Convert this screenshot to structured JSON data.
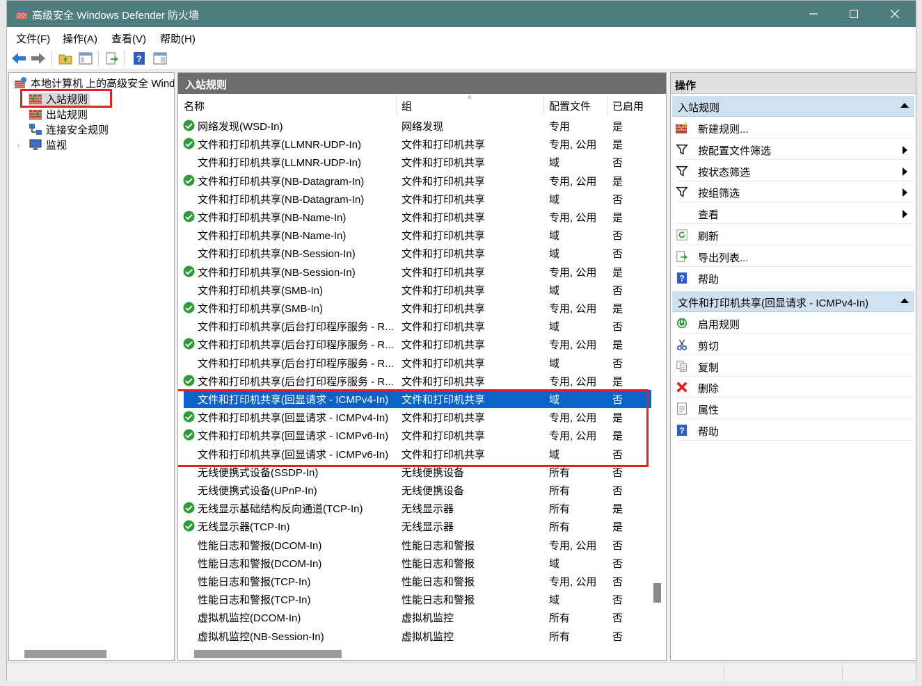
{
  "window": {
    "title": "高级安全 Windows Defender 防火墙",
    "minimize": "—",
    "maximize": "☐",
    "close": "✕"
  },
  "menu": [
    "文件(F)",
    "操作(A)",
    "查看(V)",
    "帮助(H)"
  ],
  "toolbar": [
    "back-icon",
    "forward-icon",
    "up-folder-icon",
    "show-hide-tree-icon",
    "export-icon",
    "help-icon",
    "properties-pane-icon"
  ],
  "tree": {
    "root": "本地计算机 上的高级安全 Windows Defender 防火墙",
    "items": [
      "入站规则",
      "出站规则",
      "连接安全规则",
      "监视"
    ],
    "selected": "入站规则"
  },
  "center": {
    "title": "入站规则",
    "columns": [
      "名称",
      "组",
      "配置文件",
      "已启用"
    ],
    "rows": [
      {
        "enabled_icon": true,
        "name": "网络发现(WSD-In)",
        "group": "网络发现",
        "profile": "专用",
        "enabled": "是"
      },
      {
        "enabled_icon": true,
        "name": "文件和打印机共享(LLMNR-UDP-In)",
        "group": "文件和打印机共享",
        "profile": "专用, 公用",
        "enabled": "是"
      },
      {
        "enabled_icon": false,
        "name": "文件和打印机共享(LLMNR-UDP-In)",
        "group": "文件和打印机共享",
        "profile": "域",
        "enabled": "否"
      },
      {
        "enabled_icon": true,
        "name": "文件和打印机共享(NB-Datagram-In)",
        "group": "文件和打印机共享",
        "profile": "专用, 公用",
        "enabled": "是"
      },
      {
        "enabled_icon": false,
        "name": "文件和打印机共享(NB-Datagram-In)",
        "group": "文件和打印机共享",
        "profile": "域",
        "enabled": "否"
      },
      {
        "enabled_icon": true,
        "name": "文件和打印机共享(NB-Name-In)",
        "group": "文件和打印机共享",
        "profile": "专用, 公用",
        "enabled": "是"
      },
      {
        "enabled_icon": false,
        "name": "文件和打印机共享(NB-Name-In)",
        "group": "文件和打印机共享",
        "profile": "域",
        "enabled": "否"
      },
      {
        "enabled_icon": false,
        "name": "文件和打印机共享(NB-Session-In)",
        "group": "文件和打印机共享",
        "profile": "域",
        "enabled": "否"
      },
      {
        "enabled_icon": true,
        "name": "文件和打印机共享(NB-Session-In)",
        "group": "文件和打印机共享",
        "profile": "专用, 公用",
        "enabled": "是"
      },
      {
        "enabled_icon": false,
        "name": "文件和打印机共享(SMB-In)",
        "group": "文件和打印机共享",
        "profile": "域",
        "enabled": "否"
      },
      {
        "enabled_icon": true,
        "name": "文件和打印机共享(SMB-In)",
        "group": "文件和打印机共享",
        "profile": "专用, 公用",
        "enabled": "是"
      },
      {
        "enabled_icon": false,
        "name": "文件和打印机共享(后台打印程序服务 - R...",
        "group": "文件和打印机共享",
        "profile": "域",
        "enabled": "否"
      },
      {
        "enabled_icon": true,
        "name": "文件和打印机共享(后台打印程序服务 - R...",
        "group": "文件和打印机共享",
        "profile": "专用, 公用",
        "enabled": "是"
      },
      {
        "enabled_icon": false,
        "name": "文件和打印机共享(后台打印程序服务 - R...",
        "group": "文件和打印机共享",
        "profile": "域",
        "enabled": "否"
      },
      {
        "enabled_icon": true,
        "name": "文件和打印机共享(后台打印程序服务 - R...",
        "group": "文件和打印机共享",
        "profile": "专用, 公用",
        "enabled": "是"
      },
      {
        "enabled_icon": false,
        "name": "文件和打印机共享(回显请求 - ICMPv4-In)",
        "group": "文件和打印机共享",
        "profile": "域",
        "enabled": "否",
        "selected": true
      },
      {
        "enabled_icon": true,
        "name": "文件和打印机共享(回显请求 - ICMPv4-In)",
        "group": "文件和打印机共享",
        "profile": "专用, 公用",
        "enabled": "是"
      },
      {
        "enabled_icon": true,
        "name": "文件和打印机共享(回显请求 - ICMPv6-In)",
        "group": "文件和打印机共享",
        "profile": "专用, 公用",
        "enabled": "是"
      },
      {
        "enabled_icon": false,
        "name": "文件和打印机共享(回显请求 - ICMPv6-In)",
        "group": "文件和打印机共享",
        "profile": "域",
        "enabled": "否"
      },
      {
        "enabled_icon": false,
        "name": "无线便携式设备(SSDP-In)",
        "group": "无线便携设备",
        "profile": "所有",
        "enabled": "否"
      },
      {
        "enabled_icon": false,
        "name": "无线便携式设备(UPnP-In)",
        "group": "无线便携设备",
        "profile": "所有",
        "enabled": "否"
      },
      {
        "enabled_icon": true,
        "name": "无线显示基础结构反向通道(TCP-In)",
        "group": "无线显示器",
        "profile": "所有",
        "enabled": "是"
      },
      {
        "enabled_icon": true,
        "name": "无线显示器(TCP-In)",
        "group": "无线显示器",
        "profile": "所有",
        "enabled": "是"
      },
      {
        "enabled_icon": false,
        "name": "性能日志和警报(DCOM-In)",
        "group": "性能日志和警报",
        "profile": "专用, 公用",
        "enabled": "否"
      },
      {
        "enabled_icon": false,
        "name": "性能日志和警报(DCOM-In)",
        "group": "性能日志和警报",
        "profile": "域",
        "enabled": "否"
      },
      {
        "enabled_icon": false,
        "name": "性能日志和警报(TCP-In)",
        "group": "性能日志和警报",
        "profile": "专用, 公用",
        "enabled": "否"
      },
      {
        "enabled_icon": false,
        "name": "性能日志和警报(TCP-In)",
        "group": "性能日志和警报",
        "profile": "域",
        "enabled": "否"
      },
      {
        "enabled_icon": false,
        "name": "虚拟机监控(DCOM-In)",
        "group": "虚拟机监控",
        "profile": "所有",
        "enabled": "否"
      },
      {
        "enabled_icon": false,
        "name": "虚拟机监控(NB-Session-In)",
        "group": "虚拟机监控",
        "profile": "所有",
        "enabled": "否"
      }
    ]
  },
  "actions": {
    "title": "操作",
    "section1": {
      "title": "入站规则",
      "items": [
        {
          "label": "新建规则...",
          "icon": "new-rule-icon",
          "submenu": false
        },
        {
          "label": "按配置文件筛选",
          "icon": "filter-icon",
          "submenu": true
        },
        {
          "label": "按状态筛选",
          "icon": "filter-icon",
          "submenu": true
        },
        {
          "label": "按组筛选",
          "icon": "filter-icon",
          "submenu": true
        },
        {
          "label": "查看",
          "icon": "",
          "submenu": true
        },
        {
          "label": "刷新",
          "icon": "refresh-icon",
          "submenu": false
        },
        {
          "label": "导出列表...",
          "icon": "export-icon",
          "submenu": false
        },
        {
          "label": "帮助",
          "icon": "help-icon",
          "submenu": false
        }
      ]
    },
    "section2": {
      "title": "文件和打印机共享(回显请求 - ICMPv4-In)",
      "items": [
        {
          "label": "启用规则",
          "icon": "enable-icon"
        },
        {
          "label": "剪切",
          "icon": "cut-icon"
        },
        {
          "label": "复制",
          "icon": "copy-icon"
        },
        {
          "label": "删除",
          "icon": "delete-icon"
        },
        {
          "label": "属性",
          "icon": "properties-icon"
        },
        {
          "label": "帮助",
          "icon": "help-icon"
        }
      ]
    }
  }
}
